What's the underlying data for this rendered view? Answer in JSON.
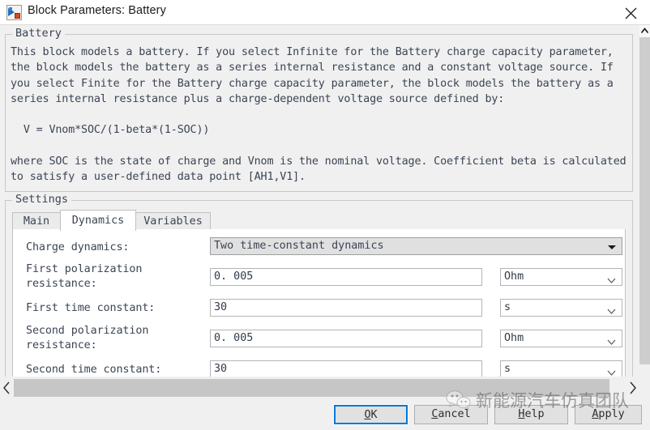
{
  "window": {
    "title": "Block Parameters: Battery",
    "icon": "simulink-block-icon",
    "close_label": "close-icon"
  },
  "description": {
    "legend": "Battery",
    "text": "This block models a battery. If you select Infinite for the Battery charge capacity parameter,\nthe block models the battery as a series internal resistance and a constant voltage source. If\nyou select Finite for the Battery charge capacity parameter, the block models the battery as a\nseries internal resistance plus a charge-dependent voltage source defined by:\n\n  V = Vnom*SOC/(1-beta*(1-SOC))\n\nwhere SOC is the state of charge and Vnom is the nominal voltage. Coefficient beta is calculated\nto satisfy a user-defined data point [AH1,V1]."
  },
  "settings": {
    "legend": "Settings",
    "tabs": [
      {
        "label": "Main",
        "active": false
      },
      {
        "label": "Dynamics",
        "active": true
      },
      {
        "label": "Variables",
        "active": false
      }
    ],
    "fields": [
      {
        "label": "Charge dynamics:",
        "control": "combo",
        "value": "Two time-constant dynamics",
        "unit": null
      },
      {
        "label": "First polarization\nresistance:",
        "control": "text",
        "value": "0. 005",
        "unit": "Ohm"
      },
      {
        "label": "First time constant:",
        "control": "text",
        "value": "30",
        "unit": "s"
      },
      {
        "label": "Second polarization\nresistance:",
        "control": "text",
        "value": "0. 005",
        "unit": "Ohm"
      },
      {
        "label": "Second time constant:",
        "control": "text",
        "value": "30",
        "unit": "s"
      }
    ]
  },
  "buttons": {
    "ok": {
      "pre": "",
      "mnemonic": "O",
      "post": "K",
      "focused": true
    },
    "cancel": {
      "pre": "",
      "mnemonic": "C",
      "post": "ancel",
      "focused": false
    },
    "help": {
      "pre": "",
      "mnemonic": "H",
      "post": "elp",
      "focused": false
    },
    "apply": {
      "pre": "",
      "mnemonic": "A",
      "post": "pply",
      "focused": false
    }
  },
  "watermark": {
    "text": "新能源汽车仿真团队",
    "icon": "wechat-icon"
  },
  "colors": {
    "dialog_bg": "#f0f0f0",
    "panel_bg": "#ffffff",
    "text": "#3b4454",
    "focus_blue": "#0078d7",
    "combo_bg": "#e0e0e0",
    "scroll_thumb": "#cdcdcd"
  }
}
